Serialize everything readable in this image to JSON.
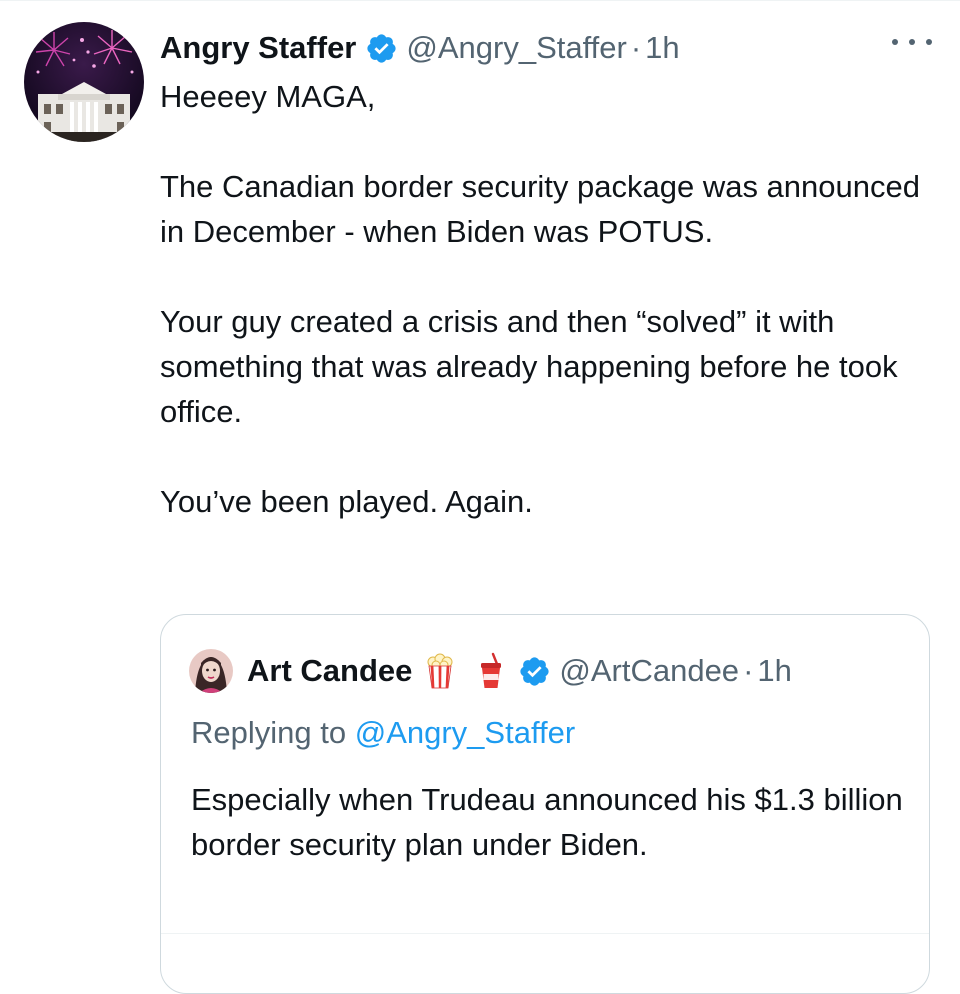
{
  "tweet": {
    "author": {
      "display_name": "Angry Staffer",
      "handle": "@Angry_Staffer",
      "separator": "·",
      "time": "1h",
      "verified": true,
      "avatar_icon": "white-house-fireworks-avatar"
    },
    "more_icon": "ellipsis-icon",
    "paragraphs": [
      "Heeeey MAGA,",
      "The Canadian border security package was announced in December - when Biden was POTUS.",
      "Your guy created a crisis and then “solved” it with something that was already happening before he took office.",
      "You’ve been played. Again."
    ]
  },
  "quoted_tweet": {
    "author": {
      "display_name": "Art Candee",
      "emojis": [
        "popcorn-icon",
        "soda-cup-icon"
      ],
      "handle": "@ArtCandee",
      "separator": "·",
      "time": "1h",
      "verified": true,
      "avatar_icon": "art-candee-avatar"
    },
    "replying_prefix": "Replying to",
    "replying_to": "@Angry_Staffer",
    "text": "Especially when Trudeau announced his $1.3 billion border security plan under Biden."
  },
  "colors": {
    "text_primary": "#0f1419",
    "text_secondary": "#536471",
    "accent": "#1d9bf0",
    "border": "#cfd9de"
  }
}
